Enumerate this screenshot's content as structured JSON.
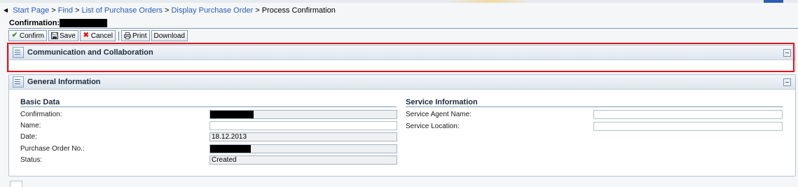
{
  "breadcrumb": {
    "items": [
      {
        "label": "Start Page",
        "link": true
      },
      {
        "label": "Find",
        "link": true
      },
      {
        "label": "List of Purchase Orders",
        "link": true
      },
      {
        "label": "Display Purchase Order",
        "link": true
      },
      {
        "label": "Process Confirmation",
        "link": false
      }
    ],
    "separator": ">"
  },
  "page": {
    "title_label": "Confirmation:"
  },
  "toolbar": {
    "confirm": "Confirm",
    "save": "Save",
    "cancel": "Cancel",
    "print": "Print",
    "download": "Download"
  },
  "panels": {
    "communication": {
      "title": "Communication and Collaboration"
    },
    "general": {
      "title": "General Information"
    }
  },
  "basic_data": {
    "title": "Basic Data",
    "confirmation_label": "Confirmation:",
    "name_label": "Name:",
    "name_value": "",
    "date_label": "Date:",
    "date_value": "18.12.2013",
    "po_label": "Purchase Order No.:",
    "status_label": "Status:",
    "status_value": "Created"
  },
  "service_info": {
    "title": "Service Information",
    "agent_label": "Service Agent Name:",
    "agent_value": "",
    "location_label": "Service Location:",
    "location_value": ""
  },
  "colors": {
    "link": "#2a5db0",
    "highlight": "#e0141e",
    "rule": "#7f9db9"
  }
}
